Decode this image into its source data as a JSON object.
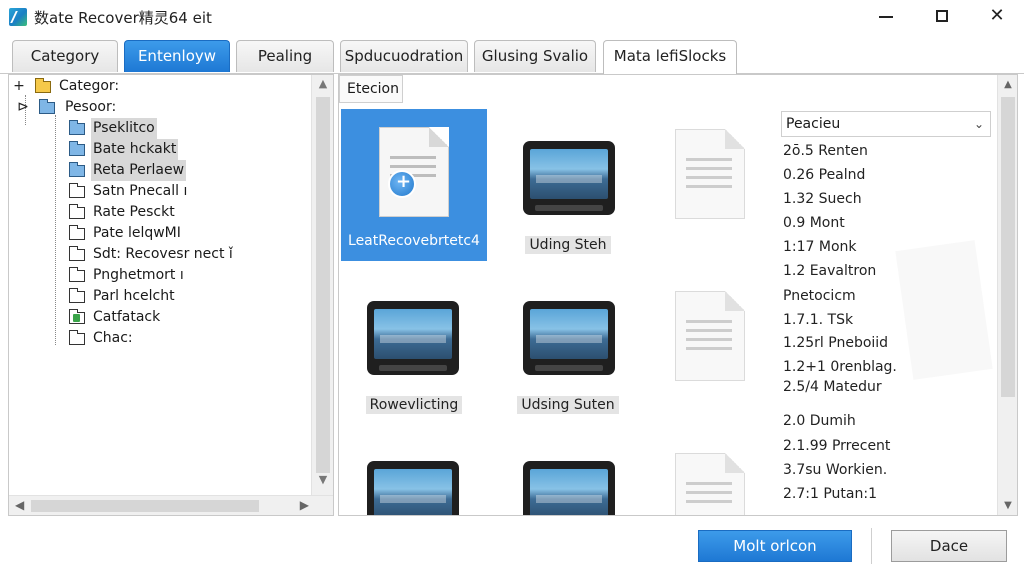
{
  "window": {
    "title": "数ate Recover精灵64 eit",
    "minimize_icon": "minimize-icon",
    "maximize_icon": "maximize-icon",
    "close_label": "✕"
  },
  "tabs": [
    {
      "label": "Category",
      "style": "normal"
    },
    {
      "label": "Entenloyw",
      "style": "blue"
    },
    {
      "label": "Pealing",
      "style": "normal"
    },
    {
      "label": "Spducuodration",
      "style": "normal"
    },
    {
      "label": "Glusing Svalio",
      "style": "normal"
    },
    {
      "label": "Mata lefiSlocks",
      "style": "active"
    }
  ],
  "tree": {
    "items": [
      {
        "expander": "+",
        "label": "Categor:",
        "folder": "yellow",
        "highlight": false
      },
      {
        "expander": "⊳",
        "label": "Pesoor:",
        "folder": "blue",
        "highlight": false
      },
      {
        "expander": "",
        "label": "Pseklitco",
        "folder": "blue",
        "highlight": true
      },
      {
        "expander": "",
        "label": "Bate hckakt",
        "folder": "blue",
        "highlight": true
      },
      {
        "expander": "",
        "label": "Reta Perlaew",
        "folder": "blue",
        "highlight": true
      },
      {
        "expander": "",
        "label": "Satn Pnecall ı",
        "folder": "plain",
        "highlight": false
      },
      {
        "expander": "",
        "label": "Rate Pesckt",
        "folder": "plain",
        "highlight": false
      },
      {
        "expander": "",
        "label": "Pate lelqwMI",
        "folder": "plain",
        "highlight": false
      },
      {
        "expander": "",
        "label": "Sdt: Recovesr nect ǐ",
        "folder": "plain",
        "highlight": false
      },
      {
        "expander": "",
        "label": "Pnghetmort ı",
        "folder": "plain",
        "highlight": false
      },
      {
        "expander": "",
        "label": "Parl hcelcht",
        "folder": "plain",
        "highlight": false
      },
      {
        "expander": "",
        "label": "Catfatack",
        "folder": "green",
        "highlight": false
      },
      {
        "expander": "",
        "label": "Chac:",
        "folder": "plain",
        "highlight": false
      }
    ]
  },
  "content": {
    "view_header": "Etecion",
    "files": [
      {
        "label": "LeatRecovebrtetc4",
        "icon": "document-recover-icon",
        "selected": true
      },
      {
        "label": "Uding Steh",
        "icon": "monitor-icon",
        "selected": false
      },
      {
        "label": "",
        "icon": "document-icon",
        "selected": false
      },
      {
        "label": "Rowevlicting",
        "icon": "monitor-icon",
        "selected": false
      },
      {
        "label": "Udsing Suten",
        "icon": "monitor-icon",
        "selected": false
      },
      {
        "label": "",
        "icon": "document-icon",
        "selected": false
      },
      {
        "label": "",
        "icon": "monitor-icon",
        "selected": false
      },
      {
        "label": "",
        "icon": "monitor-icon",
        "selected": false
      },
      {
        "label": "",
        "icon": "document-icon",
        "selected": false
      }
    ],
    "dropdown_value": "Peacieu",
    "list": [
      "2ō.5 Renten",
      "0.26 Pealnd",
      "1.32 Suech",
      "0.9 Mont",
      "1:17 Monk",
      "1.2 Eavaltron",
      "Pnetocicm",
      "1.7.1. TSk",
      "1.25rl Pneboiid",
      "1.2+1 0renblag.",
      "2.5/4 Matedur",
      "2.0 Dumih",
      "2.1.99 Prrecent",
      "3.7su Workien.",
      "2.7:1 Putan:1"
    ]
  },
  "buttons": {
    "primary": "Molt orlcon",
    "secondary": "Dace"
  }
}
